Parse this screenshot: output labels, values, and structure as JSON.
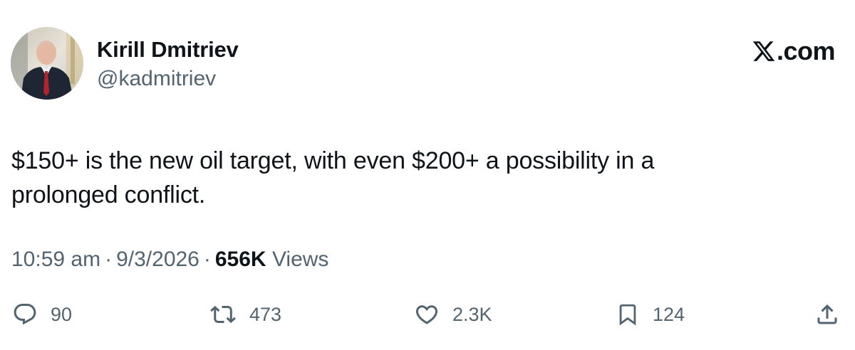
{
  "author": {
    "name": "Kirill Dmitriev",
    "handle": "@kadmitriev"
  },
  "brand": {
    "label": ".com",
    "icon": "x-logo-icon"
  },
  "tweet": {
    "text": "$150+ is the new oil target, with even $200+ a possibility in a prolonged conflict."
  },
  "meta": {
    "time": "10:59 am",
    "separator": "·",
    "date": "9/3/2026",
    "views_count": "656K",
    "views_label": "Views"
  },
  "actions": {
    "reply": {
      "icon": "reply-icon",
      "count": "90"
    },
    "retweet": {
      "icon": "retweet-icon",
      "count": "473"
    },
    "like": {
      "icon": "heart-icon",
      "count": "2.3K"
    },
    "bookmark": {
      "icon": "bookmark-icon",
      "count": "124"
    },
    "share": {
      "icon": "share-icon"
    }
  },
  "colors": {
    "text_primary": "#0f1419",
    "text_secondary": "#536471",
    "background": "#ffffff"
  }
}
